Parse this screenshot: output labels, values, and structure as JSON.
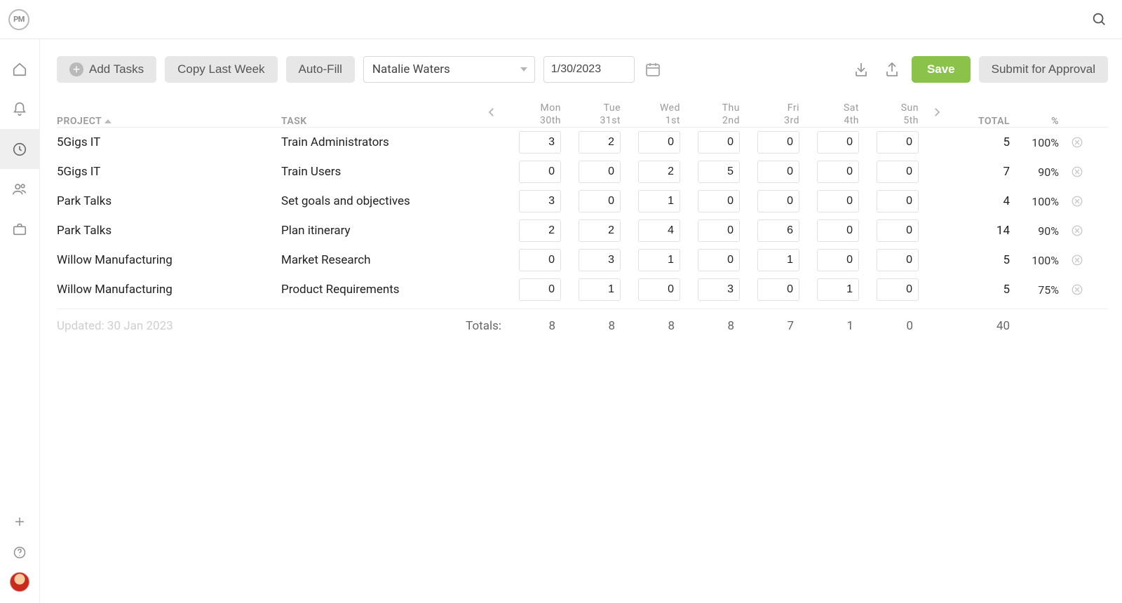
{
  "toolbar": {
    "add_tasks": "Add Tasks",
    "copy_last_week": "Copy Last Week",
    "auto_fill": "Auto-Fill",
    "user": "Natalie Waters",
    "date": "1/30/2023",
    "save": "Save",
    "submit": "Submit for Approval"
  },
  "columns": {
    "project": "PROJECT",
    "task": "TASK",
    "days": [
      {
        "d1": "Mon",
        "d2": "30th"
      },
      {
        "d1": "Tue",
        "d2": "31st"
      },
      {
        "d1": "Wed",
        "d2": "1st"
      },
      {
        "d1": "Thu",
        "d2": "2nd"
      },
      {
        "d1": "Fri",
        "d2": "3rd"
      },
      {
        "d1": "Sat",
        "d2": "4th"
      },
      {
        "d1": "Sun",
        "d2": "5th"
      }
    ],
    "total": "TOTAL",
    "percent": "%"
  },
  "rows": [
    {
      "project": "5Gigs IT",
      "task": "Train Administrators",
      "hours": [
        "3",
        "2",
        "0",
        "0",
        "0",
        "0",
        "0"
      ],
      "total": "5",
      "pct": "100%"
    },
    {
      "project": "5Gigs IT",
      "task": "Train Users",
      "hours": [
        "0",
        "0",
        "2",
        "5",
        "0",
        "0",
        "0"
      ],
      "total": "7",
      "pct": "90%"
    },
    {
      "project": "Park Talks",
      "task": "Set goals and objectives",
      "hours": [
        "3",
        "0",
        "1",
        "0",
        "0",
        "0",
        "0"
      ],
      "total": "4",
      "pct": "100%"
    },
    {
      "project": "Park Talks",
      "task": "Plan itinerary",
      "hours": [
        "2",
        "2",
        "4",
        "0",
        "6",
        "0",
        "0"
      ],
      "total": "14",
      "pct": "90%"
    },
    {
      "project": "Willow Manufacturing",
      "task": "Market Research",
      "hours": [
        "0",
        "3",
        "1",
        "0",
        "1",
        "0",
        "0"
      ],
      "total": "5",
      "pct": "100%"
    },
    {
      "project": "Willow Manufacturing",
      "task": "Product Requirements",
      "hours": [
        "0",
        "1",
        "0",
        "3",
        "0",
        "1",
        "0"
      ],
      "total": "5",
      "pct": "75%"
    }
  ],
  "totals": {
    "label": "Totals:",
    "days": [
      "8",
      "8",
      "8",
      "8",
      "7",
      "1",
      "0"
    ],
    "grand": "40"
  },
  "updated": "Updated: 30 Jan 2023"
}
